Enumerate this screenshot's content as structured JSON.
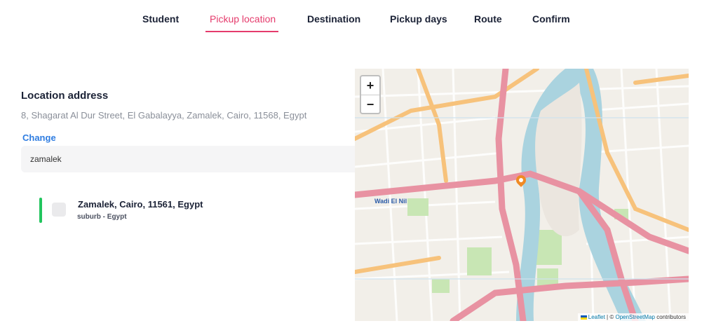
{
  "tabs": [
    {
      "label": "Student"
    },
    {
      "label": "Pickup location"
    },
    {
      "label": "Destination"
    },
    {
      "label": "Pickup days"
    },
    {
      "label": "Route"
    },
    {
      "label": "Confirm"
    }
  ],
  "active_tab": "Pickup location",
  "location": {
    "title": "Location address",
    "address": "8, Shagarat Al Dur Street, El Gabalayya, Zamalek, Cairo, 11568, Egypt",
    "change_label": "Change"
  },
  "search": {
    "value": "zamalek"
  },
  "results": [
    {
      "title": "Zamalek, Cairo, 11561, Egypt",
      "subtitle": "suburb - Egypt"
    }
  ],
  "map": {
    "zoom_in": "+",
    "zoom_out": "−",
    "label_wadi": "Wadi El Nil",
    "attribution_leaflet": "Leaflet",
    "attribution_sep": "| ©",
    "attribution_osm": "OpenStreetMap",
    "attribution_rest": "contributors",
    "colors": {
      "river": "#aad3df",
      "major_road": "#e892a2",
      "secondary_road": "#f7c27b",
      "park": "#c8e6b4"
    }
  },
  "colors": {
    "accent": "#e53b6c",
    "link": "#2f7de1",
    "selected_bar": "#22c55e"
  }
}
